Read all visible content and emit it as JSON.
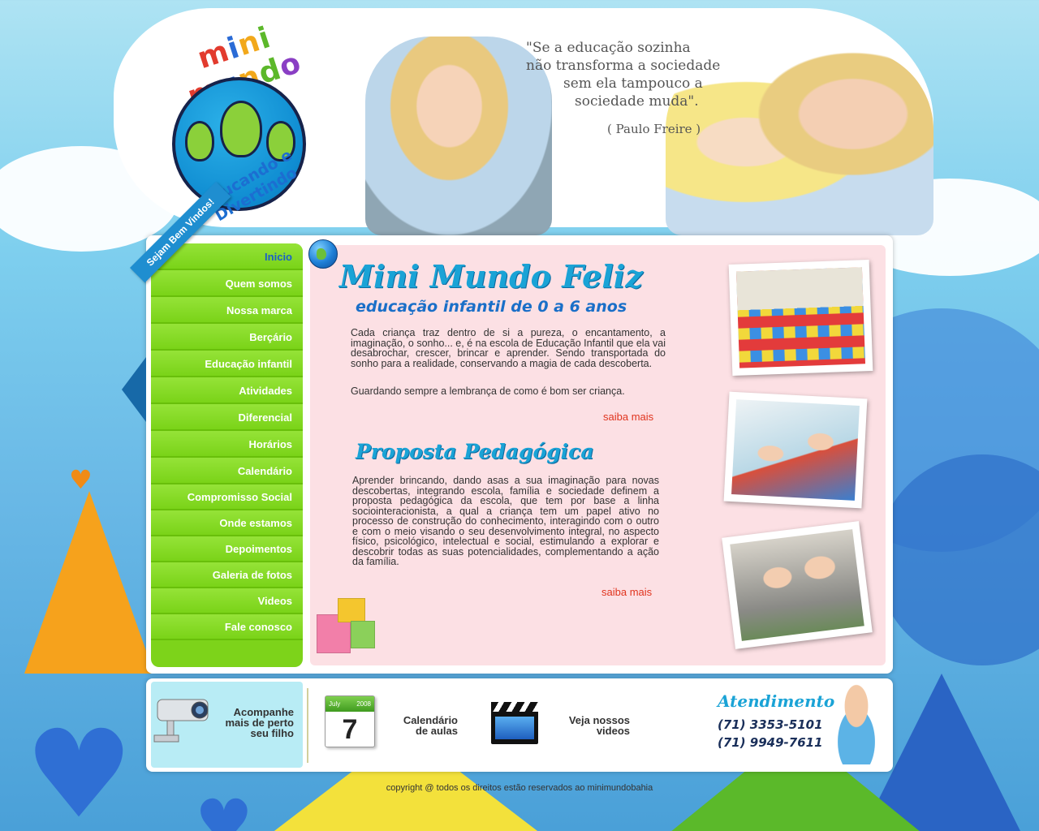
{
  "logo": {
    "word": [
      "m",
      "i",
      "n",
      "i",
      " ",
      "m",
      "u",
      "n",
      "d",
      "o"
    ],
    "tagline": "Educando e Divertindo"
  },
  "quote": {
    "lines": [
      "\"Se a educação sozinha",
      "não transforma a sociedade",
      "sem ela tampouco a",
      "sociedade muda\"."
    ],
    "author": "( Paulo Freire )"
  },
  "sidebar": {
    "ribbon": "Sejam Bem Vindos!",
    "items": [
      {
        "label": "Inicio"
      },
      {
        "label": "Quem somos"
      },
      {
        "label": "Nossa marca"
      },
      {
        "label": "Berçário"
      },
      {
        "label": "Educação infantil"
      },
      {
        "label": "Atividades"
      },
      {
        "label": "Diferencial"
      },
      {
        "label": "Horários"
      },
      {
        "label": "Calendário"
      },
      {
        "label": "Compromisso Social"
      },
      {
        "label": "Onde estamos"
      },
      {
        "label": "Depoimentos"
      },
      {
        "label": "Galeria de fotos"
      },
      {
        "label": "Videos"
      },
      {
        "label": "Fale conosco"
      }
    ]
  },
  "main": {
    "title": "Mini Mundo Feliz",
    "subtitle": "educação infantil de 0 a 6 anos",
    "intro_p1": "Cada criança traz dentro de si a pureza, o encantamento, a imaginação, o sonho... e, é na escola de Educação Infantil que ela vai desabrochar, crescer, brincar e aprender. Sendo transportada do sonho para a realidade, conservando a magia de cada descoberta.",
    "intro_p2": "Guardando sempre a lembrança de como é bom ser criança.",
    "more1": "saiba mais",
    "section2_title": "Proposta Pedagógica",
    "section2_text": "Aprender brincando, dando asas a sua imaginação para novas descobertas, integrando escola, família e sociedade definem a proposta pedagógica da escola, que tem por base a linha sociointeracionista, a qual a criança tem um papel ativo no processo de construção do conhecimento, interagindo com o outro e com o meio visando o seu desenvolvimento integral, no aspecto físico, psicológico, intelectual e social, estimulando a explorar e descobrir todas as suas potencialidades, complementando a ação da família.",
    "more2": "saiba mais"
  },
  "footer_bar": {
    "camera_label_lines": [
      "Acompanhe",
      "mais de perto",
      "seu filho"
    ],
    "calendar": {
      "month": "July",
      "year": "2008",
      "day": "7"
    },
    "calendar_label_lines": [
      "Calendário",
      "de aulas"
    ],
    "videos_label_lines": [
      "Veja nossos",
      "videos"
    ],
    "atendimento_title": "Atendimento",
    "phones": [
      "(71) 3353-5101",
      "(71) 9949-7611"
    ]
  },
  "copyright": "copyright @ todos os direitos estão reservados ao minimundobahia",
  "colors": {
    "nav_green": "#7dd31a",
    "accent_blue": "#1aa3d6",
    "link_red": "#e0341e",
    "content_pink": "#fce0e4"
  }
}
